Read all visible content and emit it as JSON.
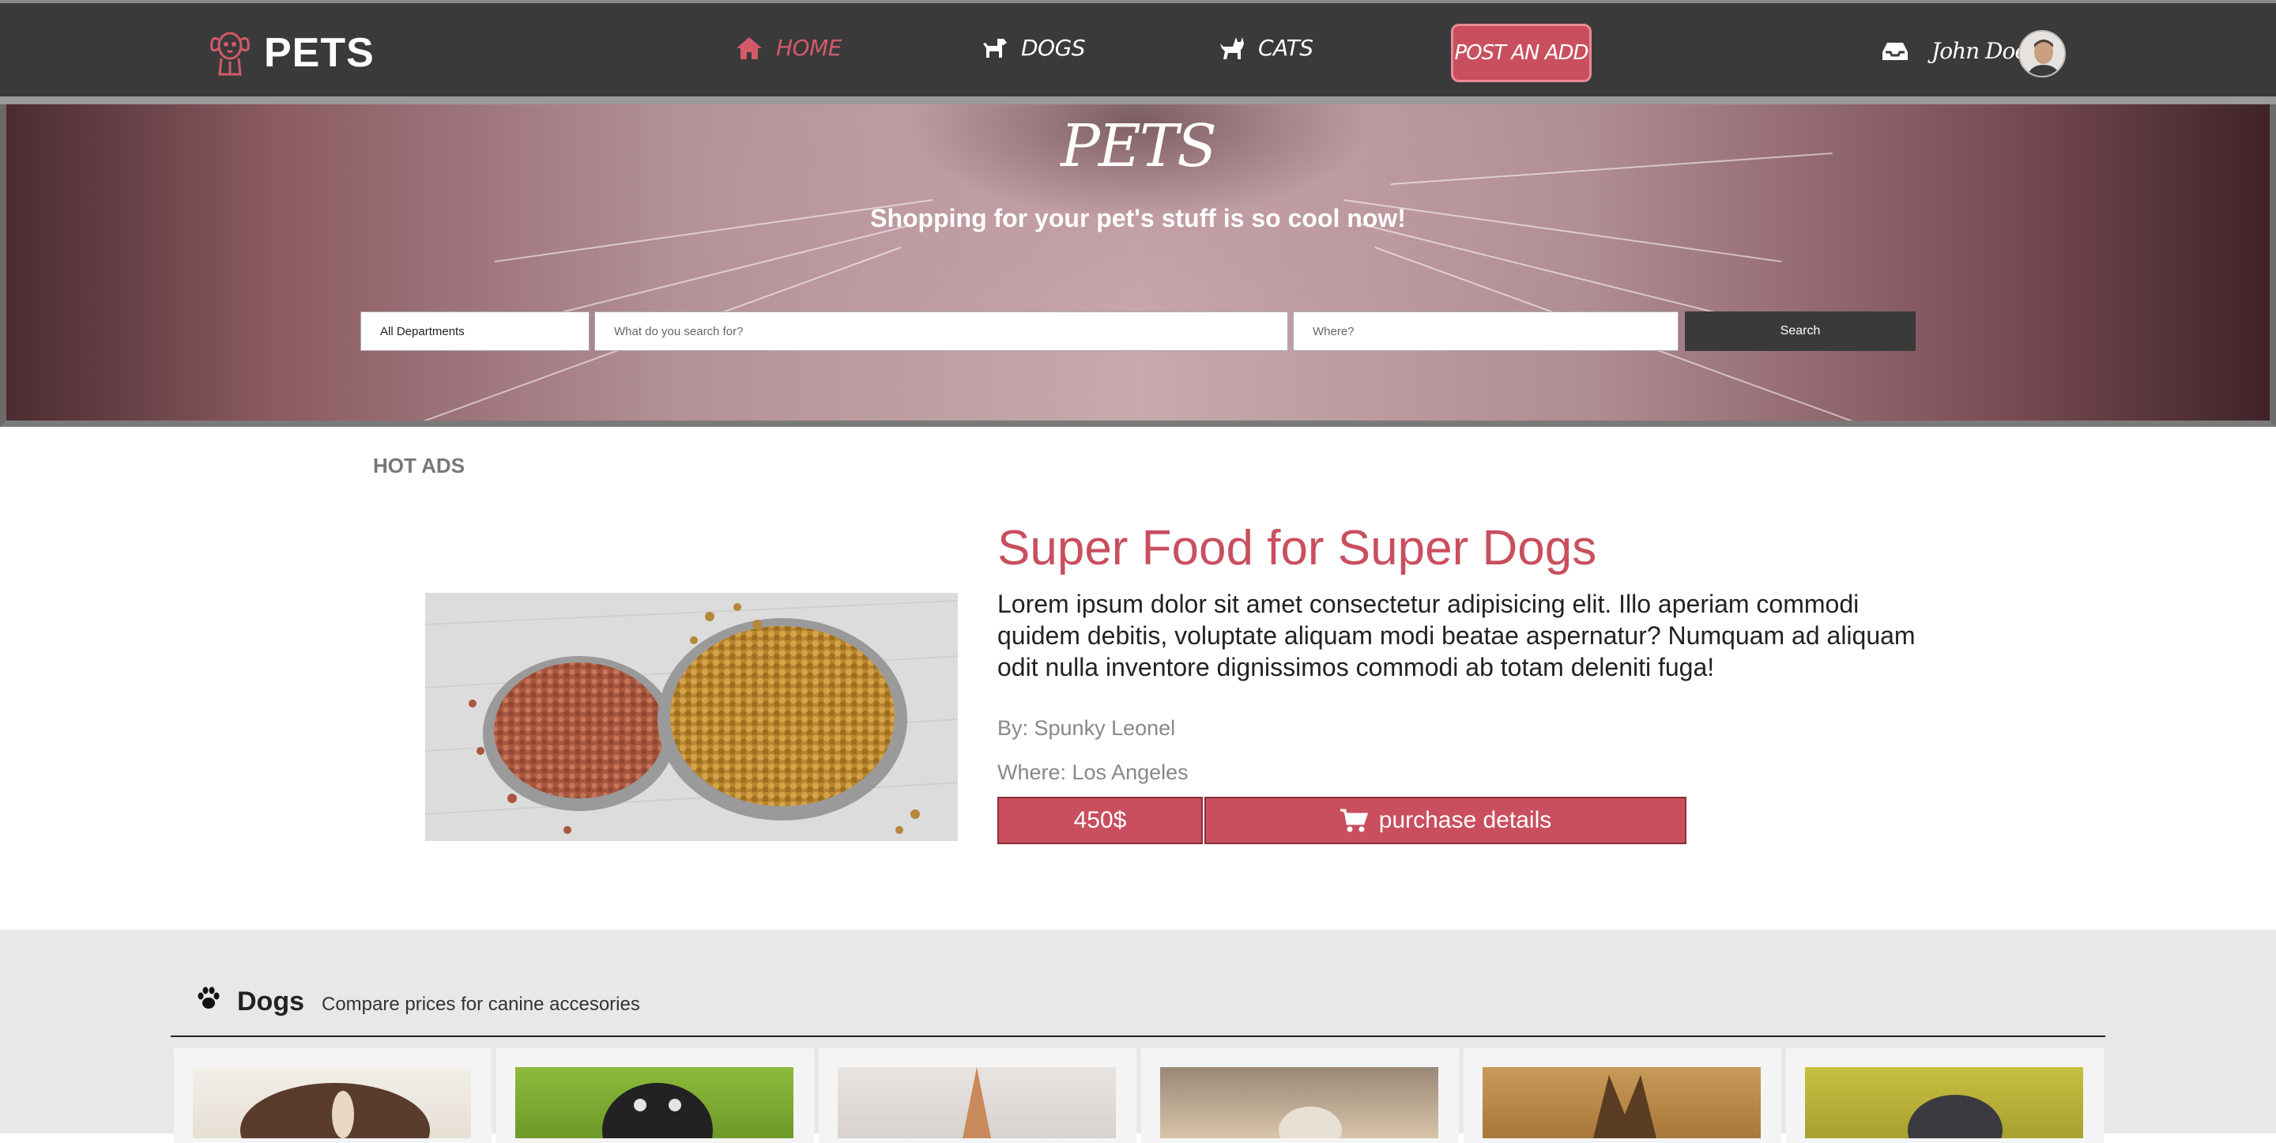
{
  "nav": {
    "logo_text": "PETS",
    "links": [
      {
        "label": "HOME",
        "active": true
      },
      {
        "label": "DOGS",
        "active": false
      },
      {
        "label": "CATS",
        "active": false
      }
    ],
    "post_button": "POST AN ADD",
    "user_name": "John Doe"
  },
  "hero": {
    "title": "PETS",
    "subtitle": "Shopping for your pet's stuff is so cool now!",
    "search": {
      "department": "All Departments",
      "what_placeholder": "What do you search for?",
      "where_placeholder": "Where?",
      "button": "Search"
    }
  },
  "hot_ads": {
    "label": "HOT ADS",
    "ad": {
      "title": "Super Food for Super Dogs",
      "description": "Lorem ipsum dolor sit amet consectetur adipisicing elit. Illo aperiam commodi quidem debitis, voluptate aliquam modi beatae aspernatur? Numquam ad aliquam odit nulla inventore dignissimos commodi ab totam deleniti fuga!",
      "by": "By: Spunky Leonel",
      "where": "Where: Los Angeles",
      "price": "450$",
      "purchase_label": "purchase details"
    }
  },
  "dogs": {
    "title": "Dogs",
    "subtitle": "Compare prices for canine accesories",
    "cards": 6
  },
  "colors": {
    "accent": "#c94f5f",
    "nav_bg": "#3a3a3a",
    "section_bg": "#e8e8e8"
  }
}
